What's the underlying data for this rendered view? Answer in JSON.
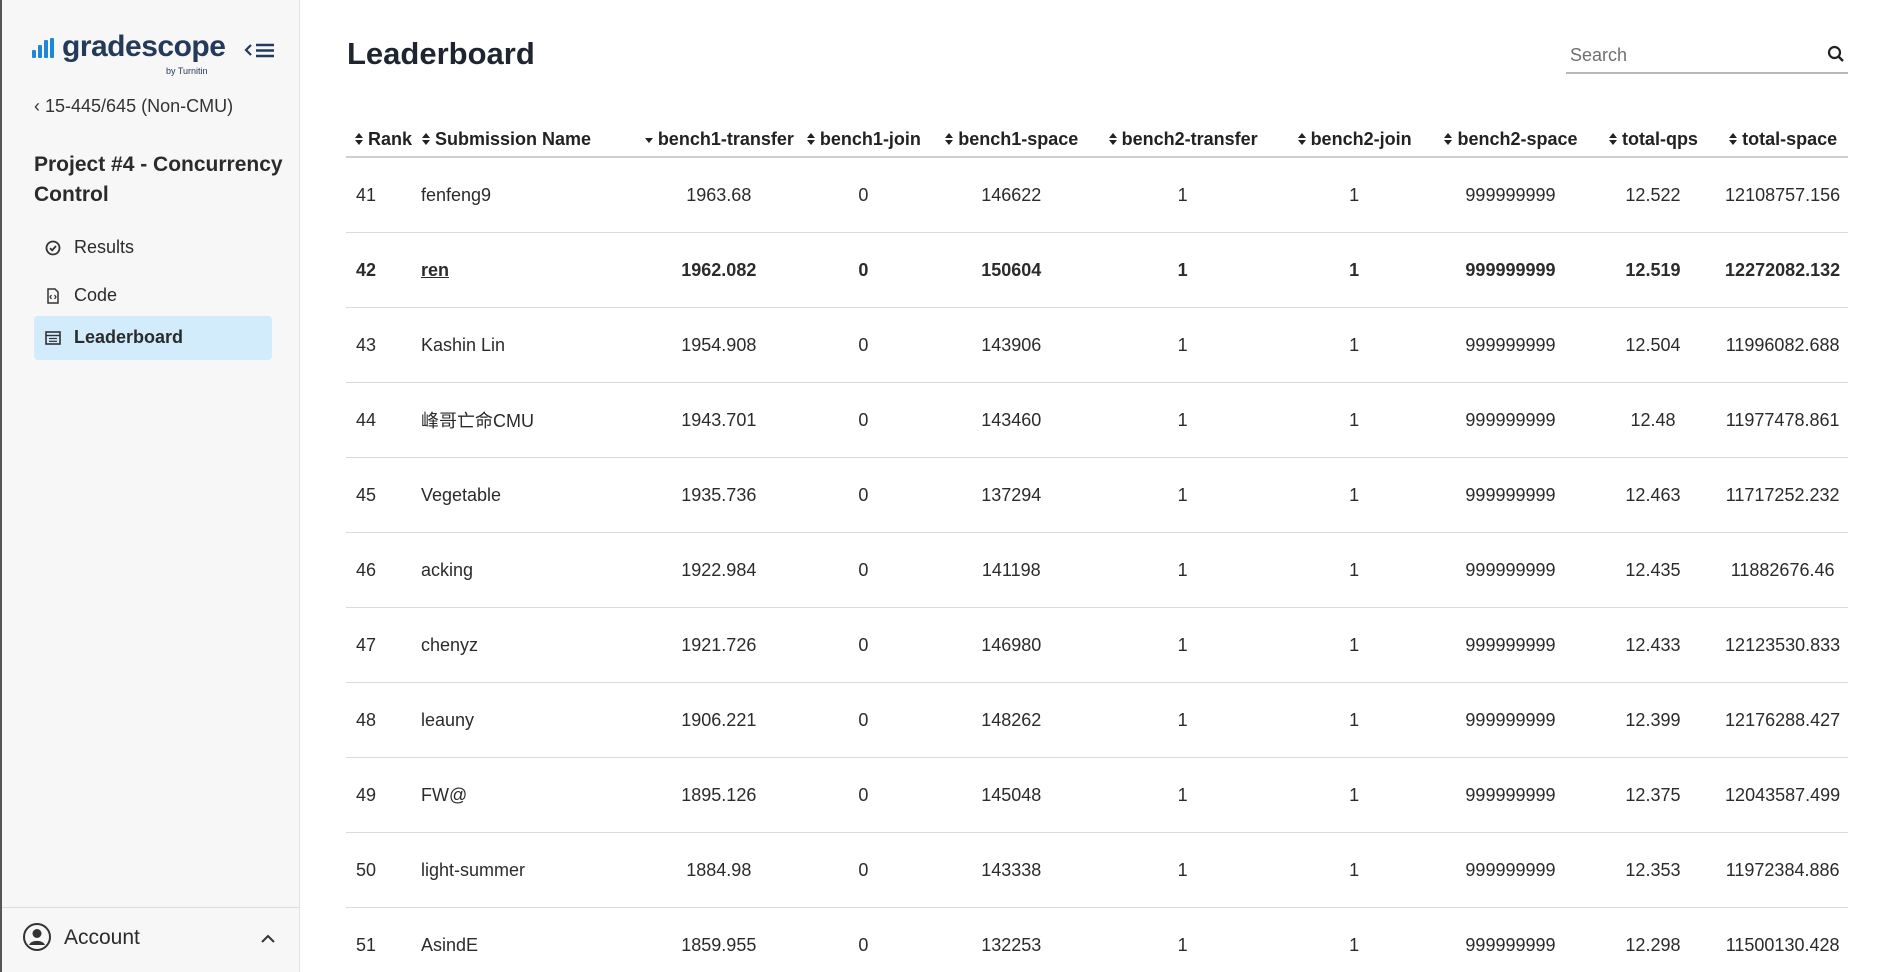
{
  "brand": {
    "name": "gradescope",
    "sub": "by Turnitin"
  },
  "sidebar": {
    "course_link": "15-445/645 (Non-CMU)",
    "assignment_title": "Project #4 - Concurrency Control",
    "items": [
      {
        "label": "Results",
        "icon": "check-circle-icon"
      },
      {
        "label": "Code",
        "icon": "code-file-icon"
      },
      {
        "label": "Leaderboard",
        "icon": "leaderboard-icon",
        "active": true
      }
    ],
    "account_label": "Account"
  },
  "header": {
    "title": "Leaderboard",
    "search_placeholder": "Search"
  },
  "table": {
    "columns": [
      "Rank",
      "Submission Name",
      "bench1-transfer",
      "bench1-join",
      "bench1-space",
      "bench2-transfer",
      "bench2-join",
      "bench2-space",
      "total-qps",
      "total-space"
    ],
    "sorted_column": "bench1-transfer",
    "sort_direction": "descending",
    "rows": [
      [
        "41",
        "fenfeng9",
        "1963.68",
        "0",
        "146622",
        "1",
        "1",
        "999999999",
        "12.522",
        "12108757.156"
      ],
      [
        "42",
        "ren",
        "1962.082",
        "0",
        "150604",
        "1",
        "1",
        "999999999",
        "12.519",
        "12272082.132"
      ],
      [
        "43",
        "Kashin Lin",
        "1954.908",
        "0",
        "143906",
        "1",
        "1",
        "999999999",
        "12.504",
        "11996082.688"
      ],
      [
        "44",
        "峰哥亡命CMU",
        "1943.701",
        "0",
        "143460",
        "1",
        "1",
        "999999999",
        "12.48",
        "11977478.861"
      ],
      [
        "45",
        "Vegetable",
        "1935.736",
        "0",
        "137294",
        "1",
        "1",
        "999999999",
        "12.463",
        "11717252.232"
      ],
      [
        "46",
        "acking",
        "1922.984",
        "0",
        "141198",
        "1",
        "1",
        "999999999",
        "12.435",
        "11882676.46"
      ],
      [
        "47",
        "chenyz",
        "1921.726",
        "0",
        "146980",
        "1",
        "1",
        "999999999",
        "12.433",
        "12123530.833"
      ],
      [
        "48",
        "leauny",
        "1906.221",
        "0",
        "148262",
        "1",
        "1",
        "999999999",
        "12.399",
        "12176288.427"
      ],
      [
        "49",
        "FW@",
        "1895.126",
        "0",
        "145048",
        "1",
        "1",
        "999999999",
        "12.375",
        "12043587.499"
      ],
      [
        "50",
        "light-summer",
        "1884.98",
        "0",
        "143338",
        "1",
        "1",
        "999999999",
        "12.353",
        "11972384.886"
      ],
      [
        "51",
        "AsindE",
        "1859.955",
        "0",
        "132253",
        "1",
        "1",
        "999999999",
        "12.298",
        "11500130.428"
      ]
    ],
    "highlight_row_index": 1
  },
  "colors": {
    "accent": "#1e88d6",
    "active_nav_bg": "#d2ecfb",
    "logo_text": "#243a5a"
  }
}
